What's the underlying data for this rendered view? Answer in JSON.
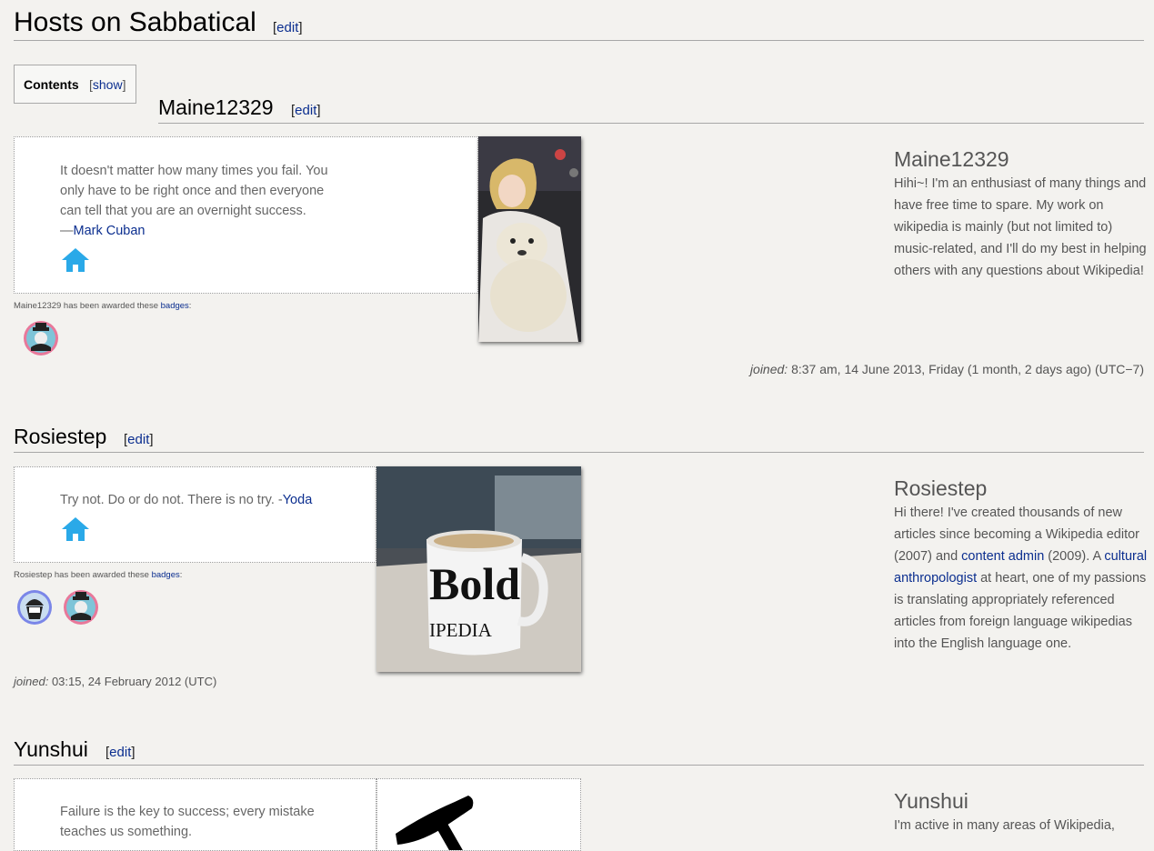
{
  "page": {
    "section_title": "Hosts on Sabbatical",
    "edit_label": "edit"
  },
  "toc": {
    "label": "Contents",
    "toggle": "show"
  },
  "hosts": [
    {
      "name": "Maine12329",
      "quote": "It doesn't matter how many times you fail. You only have to be right once and then everyone can tell that you are an overnight success.",
      "quote_dash": "—",
      "quote_author": "Mark Cuban",
      "badges_text": "Maine12329 has been awarded these",
      "badges_link": "badges",
      "badges": [
        "hat-badge"
      ],
      "bio_name": "Maine12329",
      "bio": "Hihi~! I'm an enthusiast of many things and have free time to spare. My work on wikipedia is mainly (but not limited to) music-related, and I'll do my best in helping others with any questions about Wikipedia!",
      "joined_label": "joined:",
      "joined_value": "8:37 am, 14 June 2013, Friday (1 month, 2 days ago) (UTC−7)"
    },
    {
      "name": "Rosiestep",
      "quote": "Try not. Do or do not. There is no try. -",
      "quote_author": "Yoda",
      "badges_text": "Rosiestep has been awarded these",
      "badges_link": "badges",
      "badges": [
        "cupcake-badge",
        "hat-badge"
      ],
      "bio_name": "Rosiestep",
      "bio_parts": {
        "p1": "Hi there! I've created thousands of new articles since becoming a Wikipedia editor (2007) and ",
        "link1": "content admin",
        "p2": " (2009). A ",
        "link2": "cultural anthropologist",
        "p3": " at heart, one of my passions is translating appropriately referenced articles from foreign language wikipedias into the English language one."
      },
      "mug_text1": "Bold",
      "mug_text2": "IPEDIA",
      "joined_label": "joined:",
      "joined_value": "03:15, 24 February 2012 (UTC)"
    },
    {
      "name": "Yunshui",
      "quote": "Failure is the key to success; every mistake teaches us something.",
      "bio_name": "Yunshui",
      "bio": "I'm active in many areas of Wikipedia,"
    }
  ],
  "colors": {
    "background": "#f3f2ef",
    "link": "#0b2e8f",
    "home_icon": "#2aa9e8"
  }
}
